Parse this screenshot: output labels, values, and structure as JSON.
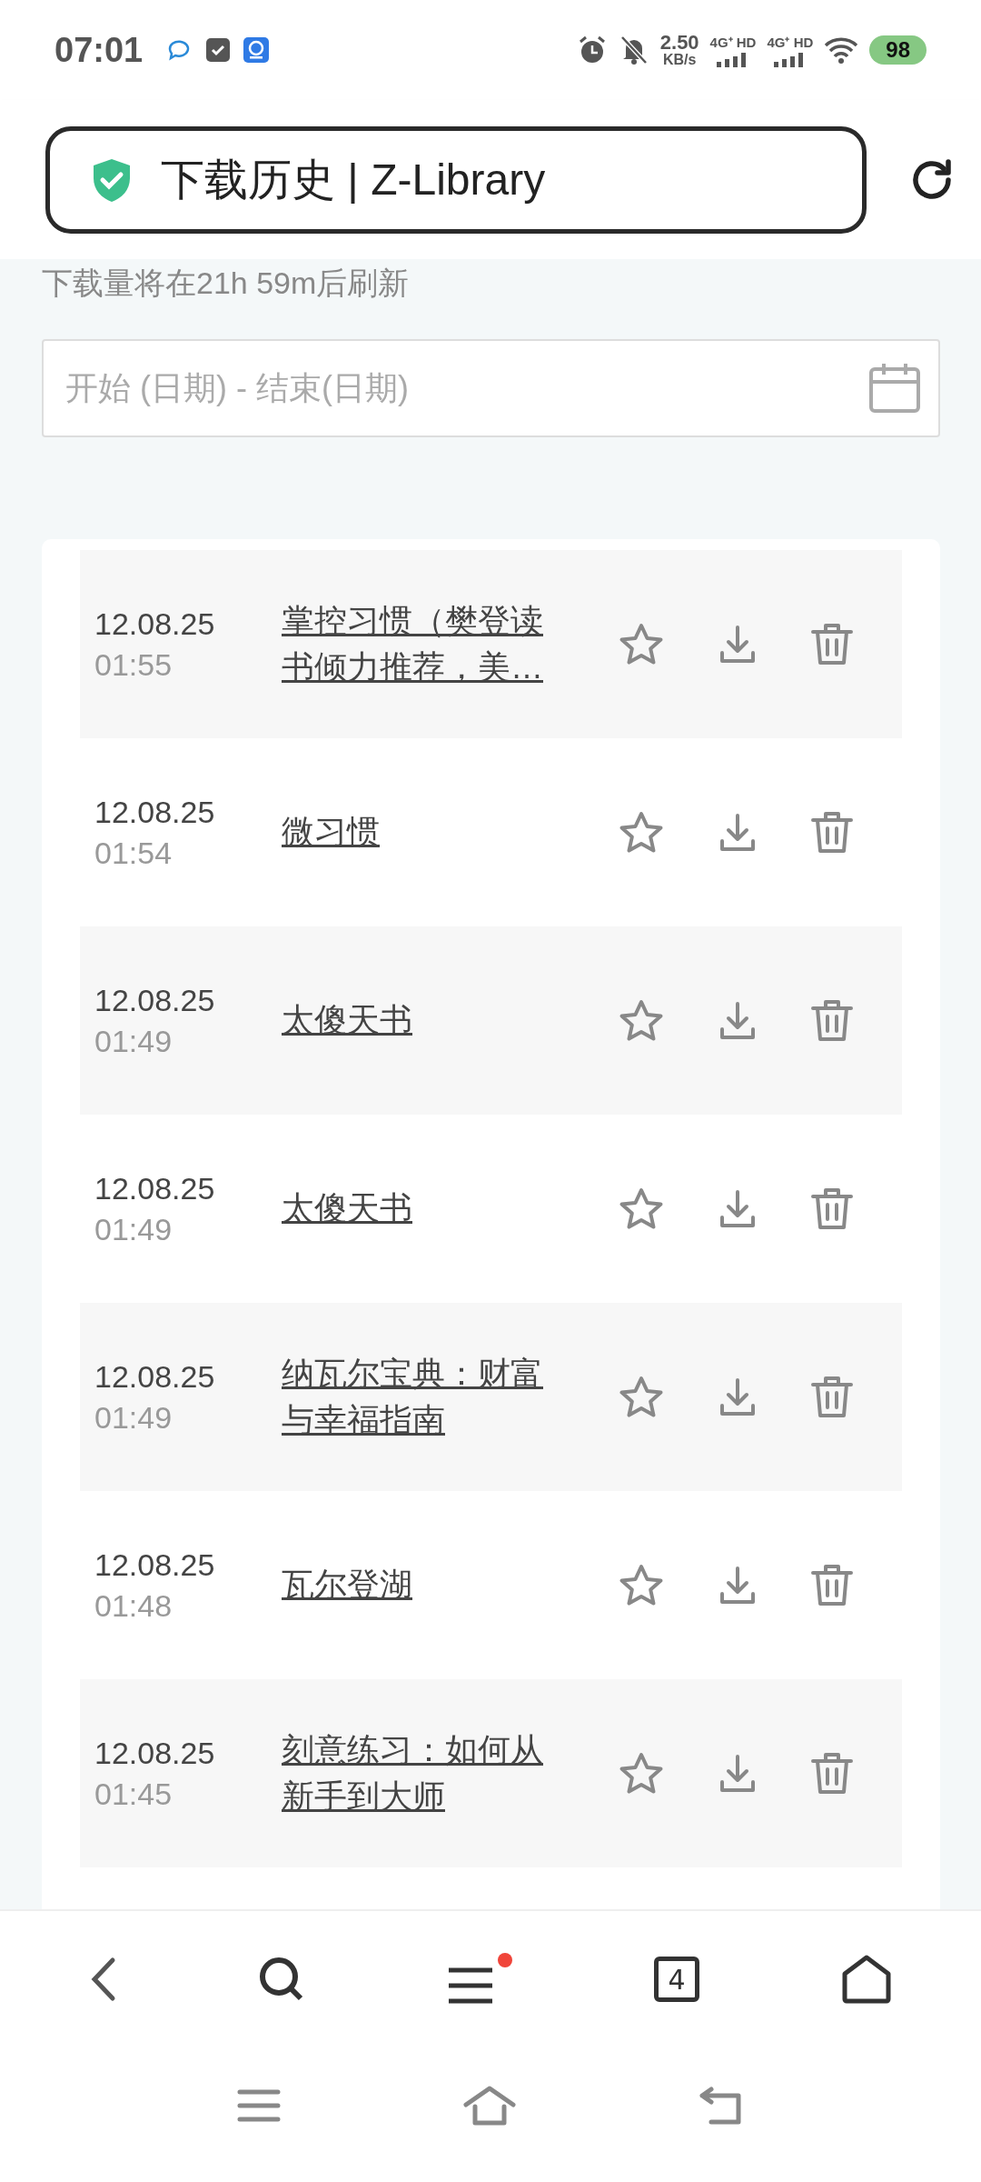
{
  "status_bar": {
    "time": "07:01",
    "net_speed": "2.50",
    "net_unit": "KB/s",
    "signals": [
      "4G⁺ HD",
      "4G⁺ HD"
    ],
    "battery": "98"
  },
  "address_bar": {
    "title": "下载历史 | Z-Library"
  },
  "notice": "下载量将在21h 59m后刷新",
  "date_range": {
    "placeholder": "开始 (日期) - 结束(日期)"
  },
  "downloads": [
    {
      "date": "12.08.25",
      "time": "01:55",
      "title": "掌控习惯（樊登读书倾力推荐，美…"
    },
    {
      "date": "12.08.25",
      "time": "01:54",
      "title": "微习惯"
    },
    {
      "date": "12.08.25",
      "time": "01:49",
      "title": "太傻天书"
    },
    {
      "date": "12.08.25",
      "time": "01:49",
      "title": "太傻天书"
    },
    {
      "date": "12.08.25",
      "time": "01:49",
      "title": "纳瓦尔宝典：财富与幸福指南"
    },
    {
      "date": "12.08.25",
      "time": "01:48",
      "title": "瓦尔登湖"
    },
    {
      "date": "12.08.25",
      "time": "01:45",
      "title": "刻意练习：如何从新手到大师"
    }
  ],
  "toolbar": {
    "tab_count": "4",
    "menu_badge": true
  }
}
